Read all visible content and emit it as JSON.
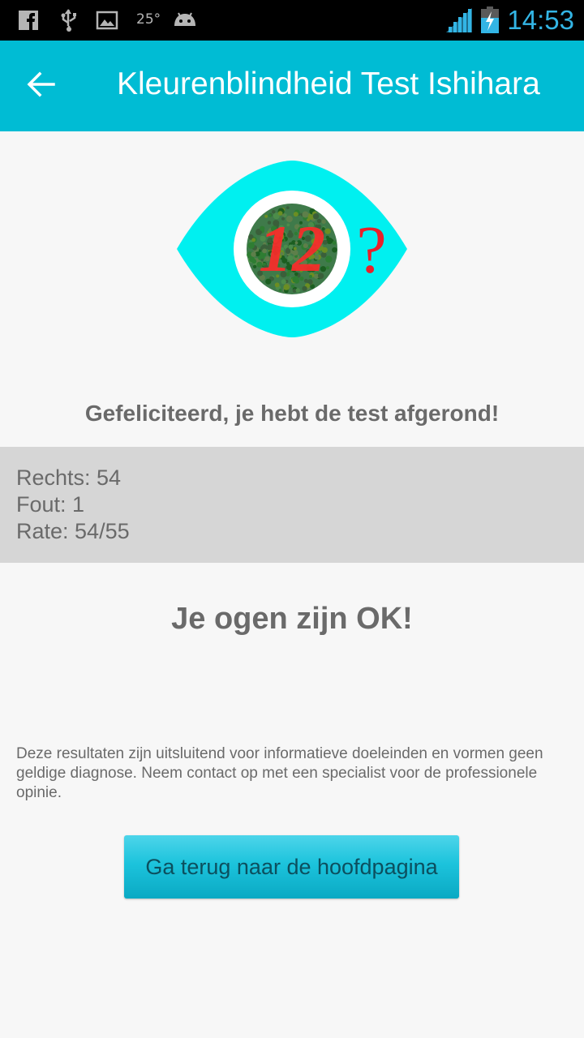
{
  "status_bar": {
    "icons": [
      "facebook-icon",
      "usb-icon",
      "image-icon",
      "android-icon",
      "signal-icon",
      "battery-charging-icon"
    ],
    "temperature": "25°",
    "time": "14:53"
  },
  "app_bar": {
    "back_icon": "arrow-left-icon",
    "title": "Kleurenblindheid Test Ishihara"
  },
  "logo": {
    "plate_number": "12",
    "question_mark": "?",
    "colors": {
      "eye": "#00f0f0",
      "dots_green": "#2e7d32",
      "dots_red": "#e53935"
    }
  },
  "congrats": "Gefeliciteerd, je hebt de test afgerond!",
  "results": {
    "right": "Rechts: 54",
    "wrong": "Fout: 1",
    "rate": "Rate: 54/55"
  },
  "verdict": "Je ogen zijn OK!",
  "disclaimer": "Deze resultaten zijn uitsluitend voor informatieve doeleinden en vormen geen geldige diagnose. Neem contact op met een specialist voor de professionele opinie.",
  "home_button_label": "Ga terug naar de hoofdpagina",
  "colors": {
    "app_bar": "#00bcd4",
    "status_time": "#33b5e5",
    "text_gray": "#6a6a6a",
    "panel_gray": "#d6d6d6"
  }
}
